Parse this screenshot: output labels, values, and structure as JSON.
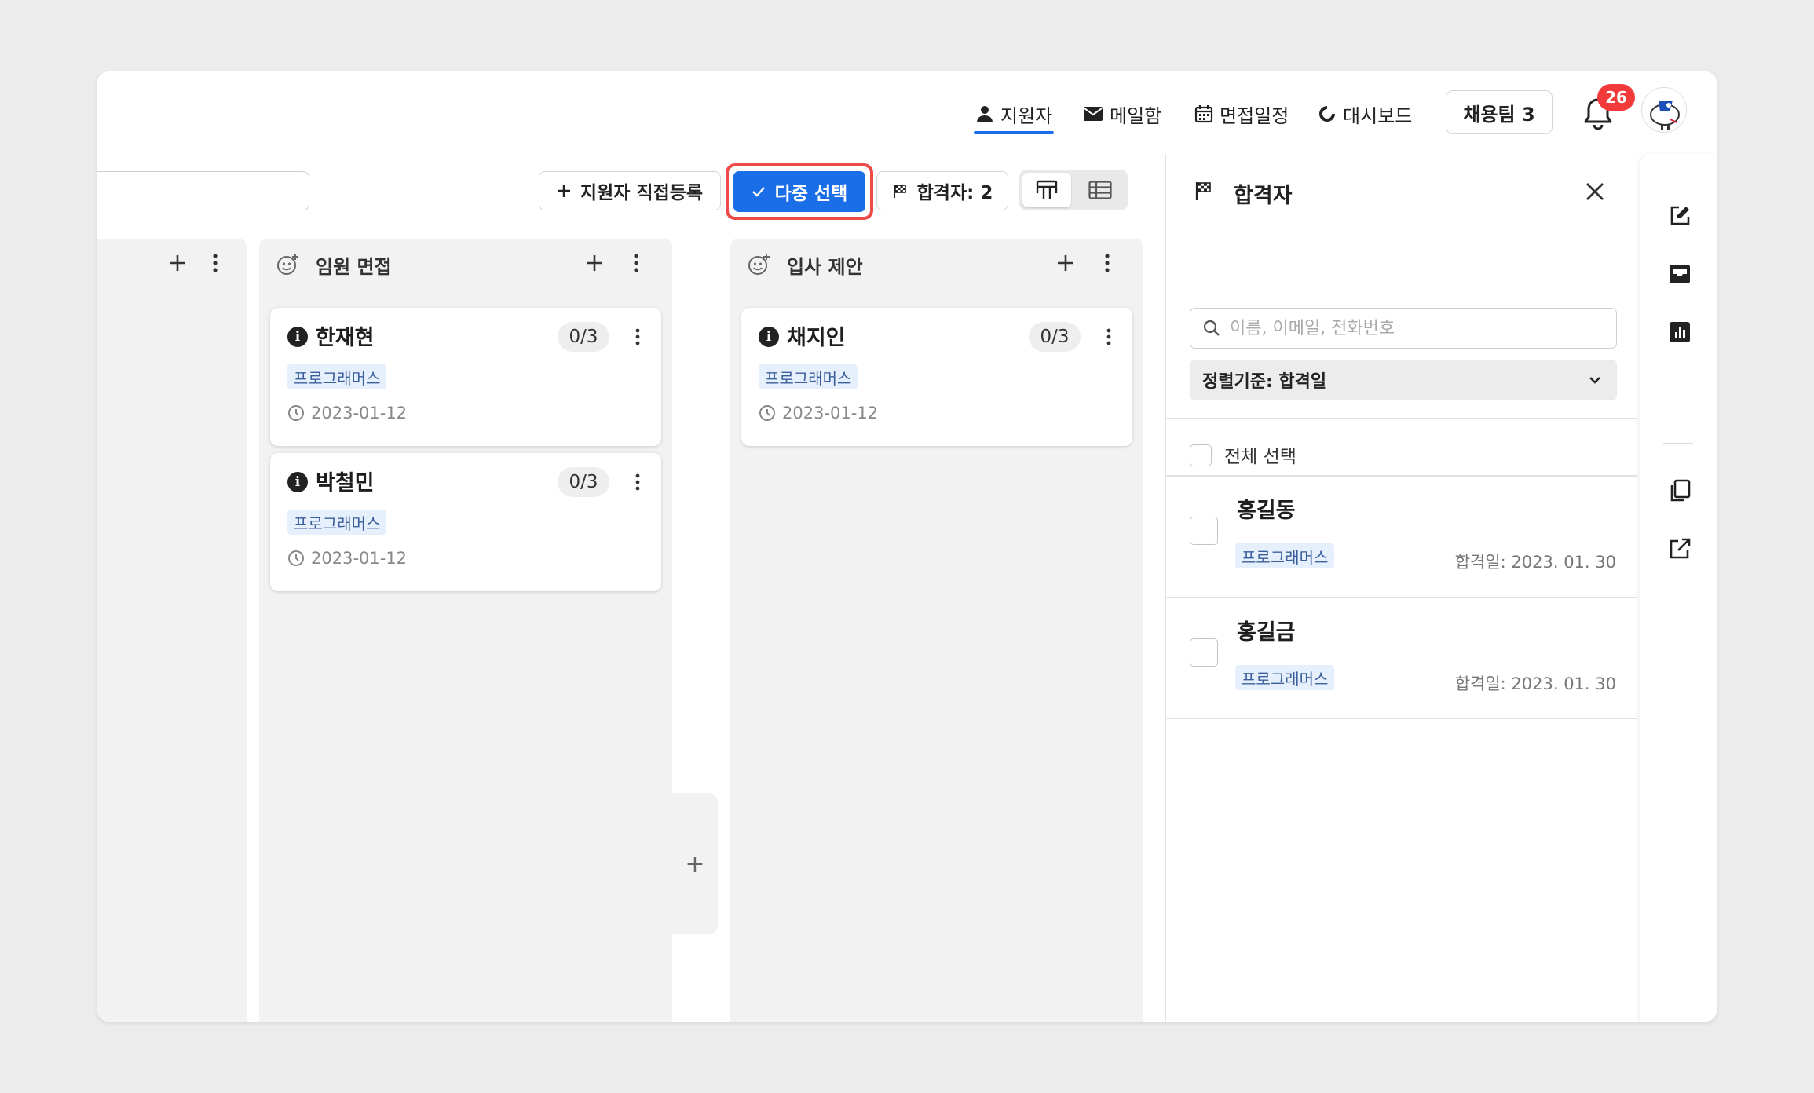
{
  "nav": {
    "applicants": "지원자",
    "mailbox": "메일함",
    "interview_schedule": "면접일정",
    "dashboard": "대시보드",
    "team": "채용팀 3",
    "notification_count": "26"
  },
  "toolbar": {
    "register_label": "지원자 직접등록",
    "multi_select_label": "다중 선택",
    "passed_label": "합격자: 2"
  },
  "columns": [
    {
      "title": "임원 면접",
      "cards": [
        {
          "name": "한재현",
          "count": "0/3",
          "tag": "프로그래머스",
          "date": "2023-01-12"
        },
        {
          "name": "박철민",
          "count": "0/3",
          "tag": "프로그래머스",
          "date": "2023-01-12"
        }
      ]
    },
    {
      "title": "입사 제안",
      "cards": [
        {
          "name": "채지인",
          "count": "0/3",
          "tag": "프로그래머스",
          "date": "2023-01-12"
        }
      ]
    }
  ],
  "add_column_label": "+",
  "panel": {
    "title": "합격자",
    "search_placeholder": "이름, 이메일, 전화번호",
    "sort_label": "정렬기준: 합격일",
    "select_all_label": "전체 선택",
    "items": [
      {
        "name": "홍길동",
        "tag": "프로그래머스",
        "date": "합격일: 2023. 01. 30"
      },
      {
        "name": "홍길금",
        "tag": "프로그래머스",
        "date": "합격일: 2023. 01. 30"
      }
    ]
  },
  "colors": {
    "accent": "#1a6ee8",
    "highlight": "#ee4a4a",
    "badge": "#f23a3a",
    "tag_bg": "#e6effc"
  }
}
